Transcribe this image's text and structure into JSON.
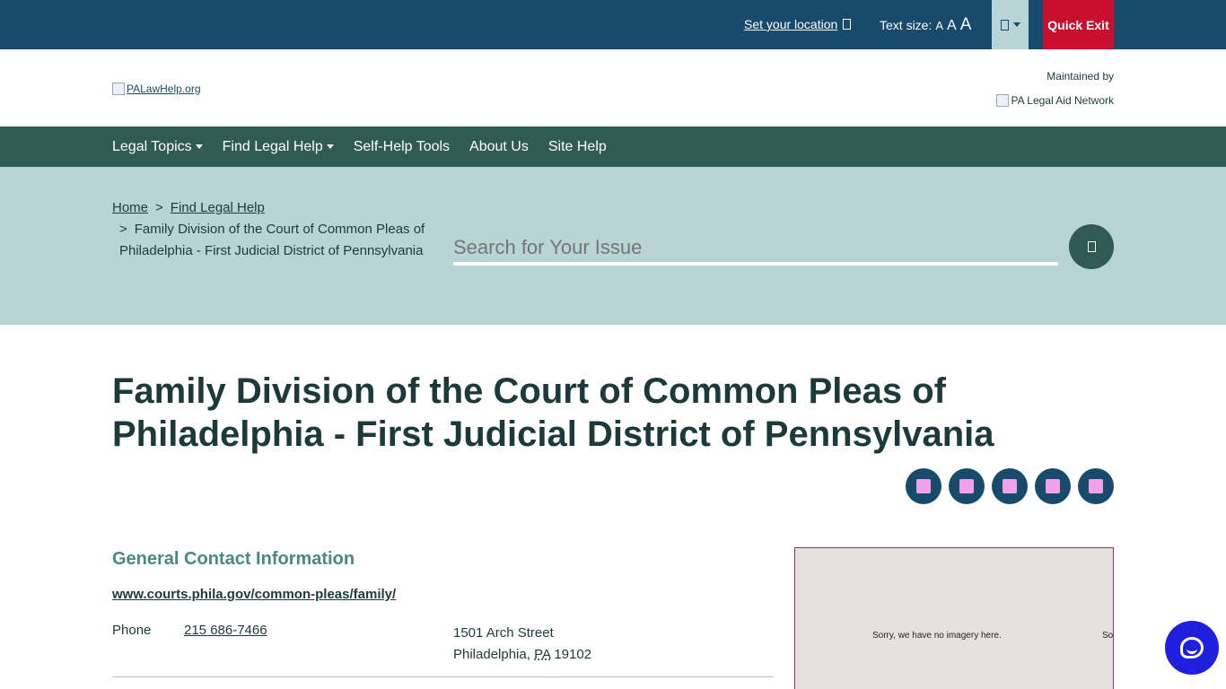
{
  "topbar": {
    "location_label": "Set your location",
    "text_size_label": "Text size:",
    "text_size_small": "A",
    "text_size_medium": "A",
    "text_size_large": "A",
    "quick_exit_label": "Quick Exit"
  },
  "header": {
    "logo_alt": "PALawHelp.org",
    "maintained_by": "Maintained by",
    "network_alt": "PA Legal Aid Network"
  },
  "nav": {
    "items": [
      {
        "label": "Legal Topics"
      },
      {
        "label": "Find Legal Help"
      },
      {
        "label": "Self-Help Tools"
      },
      {
        "label": "About Us"
      },
      {
        "label": "Site Help"
      }
    ]
  },
  "breadcrumb": {
    "home": "Home",
    "separator": ">",
    "parent": "Find Legal Help",
    "current": "Family Division of the Court of Common Pleas of Philadelphia - First Judicial District of Pennsylvania"
  },
  "search": {
    "placeholder": "Search for Your Issue"
  },
  "page": {
    "title": "Family Division of the Court of Common Pleas of Philadelphia - First Judicial District of Pennsylvania"
  },
  "contact": {
    "heading": "General Contact Information",
    "url": "www.courts.phila.gov/common-pleas/family/",
    "phone_label": "Phone",
    "phone_value": "215 686-7466",
    "address_line1": "1501 Arch Street",
    "city": "Philadelphia,",
    "state": "PA",
    "zip": "19102"
  },
  "map": {
    "no_imagery": "Sorry, we have no imagery here.",
    "no_imagery_cut": "So"
  },
  "colors": {
    "topbar": "#174a6b",
    "nav": "#305a54",
    "band": "#b9d4d4",
    "quick_exit": "#c8102e",
    "heading_accent": "#4a8a7e",
    "chat": "#1f1fdd"
  }
}
